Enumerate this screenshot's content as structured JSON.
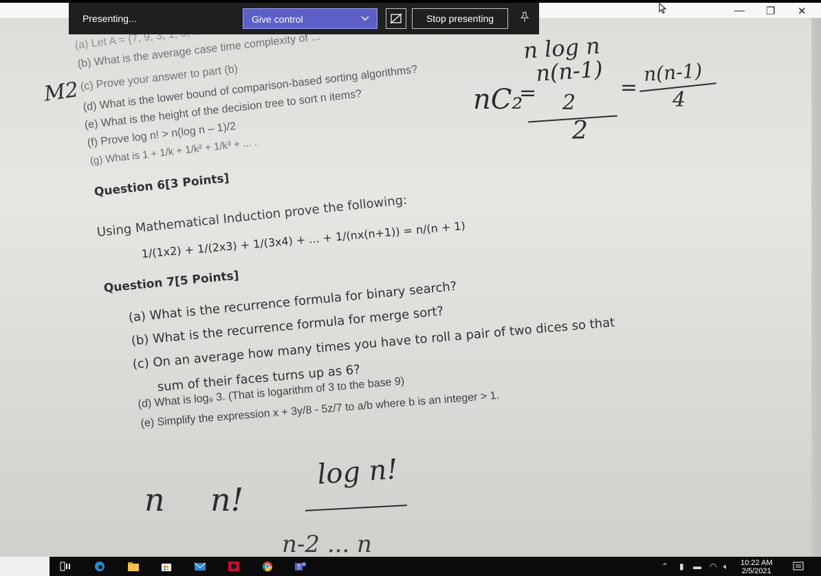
{
  "presenting_bar": {
    "status": "Presenting...",
    "give_control": "Give control",
    "stop_presenting": "Stop presenting"
  },
  "window": {
    "minimize": "—",
    "restore": "❐",
    "close": "✕"
  },
  "document": {
    "prev_items": [
      "(a) Let A = {7, 9, 3, 1, 6, ...",
      "(b) What is the average case time complexity of ...",
      "(c) Prove your answer to part (b)",
      "(d) What is the lower bound of comparison-based sorting algorithms?",
      "(e) What is the height of the decision tree to sort n items?",
      "(f) Prove log n! > n(log n – 1)/2",
      "(g) What is 1 + 1/k + 1/k² + 1/k³ + ... ."
    ],
    "q6_title": "Question 6[3 Points]",
    "q6_text": "Using Mathematical Induction prove the following:",
    "q6_formula": "1/(1x2) + 1/(2x3) + 1/(3x4) + ... + 1/(nx(n+1)) = n/(n + 1)",
    "q7_title": "Question 7[5 Points]",
    "q7_items": [
      "(a) What is the recurrence formula for binary search?",
      "(b) What is the recurrence formula for merge sort?",
      "(c) On an average how many times you have to roll a pair of two dices so that",
      "sum of their faces turns up as 6?",
      "(d) What is log₉ 3. (That is logarithm of 3 to the base 9)",
      "(e) Simplify the expression x + 3y/8 - 5z/7 to a/b where b is an integer > 1."
    ]
  },
  "handwriting": {
    "margin_mark": "M2",
    "nlogn": "n log n",
    "nc2": "nC₂",
    "frac1_num": "n(n-1)",
    "frac1_den": "2",
    "frac2_num": "n(n-1)",
    "frac2_den": "4",
    "den2": "2",
    "eq1": "=",
    "eq2": "=",
    "bottom_n": "n",
    "bottom_nfact": "n!",
    "bottom_logn": "log n!",
    "bottom_partial": "n-2 ... n"
  },
  "taskbar": {
    "time": "10:22 AM",
    "date": "2/5/2021"
  },
  "colors": {
    "presenting_bar": "#1f1f1f",
    "give_control": "#5b5fc7",
    "taskbar": "#0b0b0b"
  }
}
